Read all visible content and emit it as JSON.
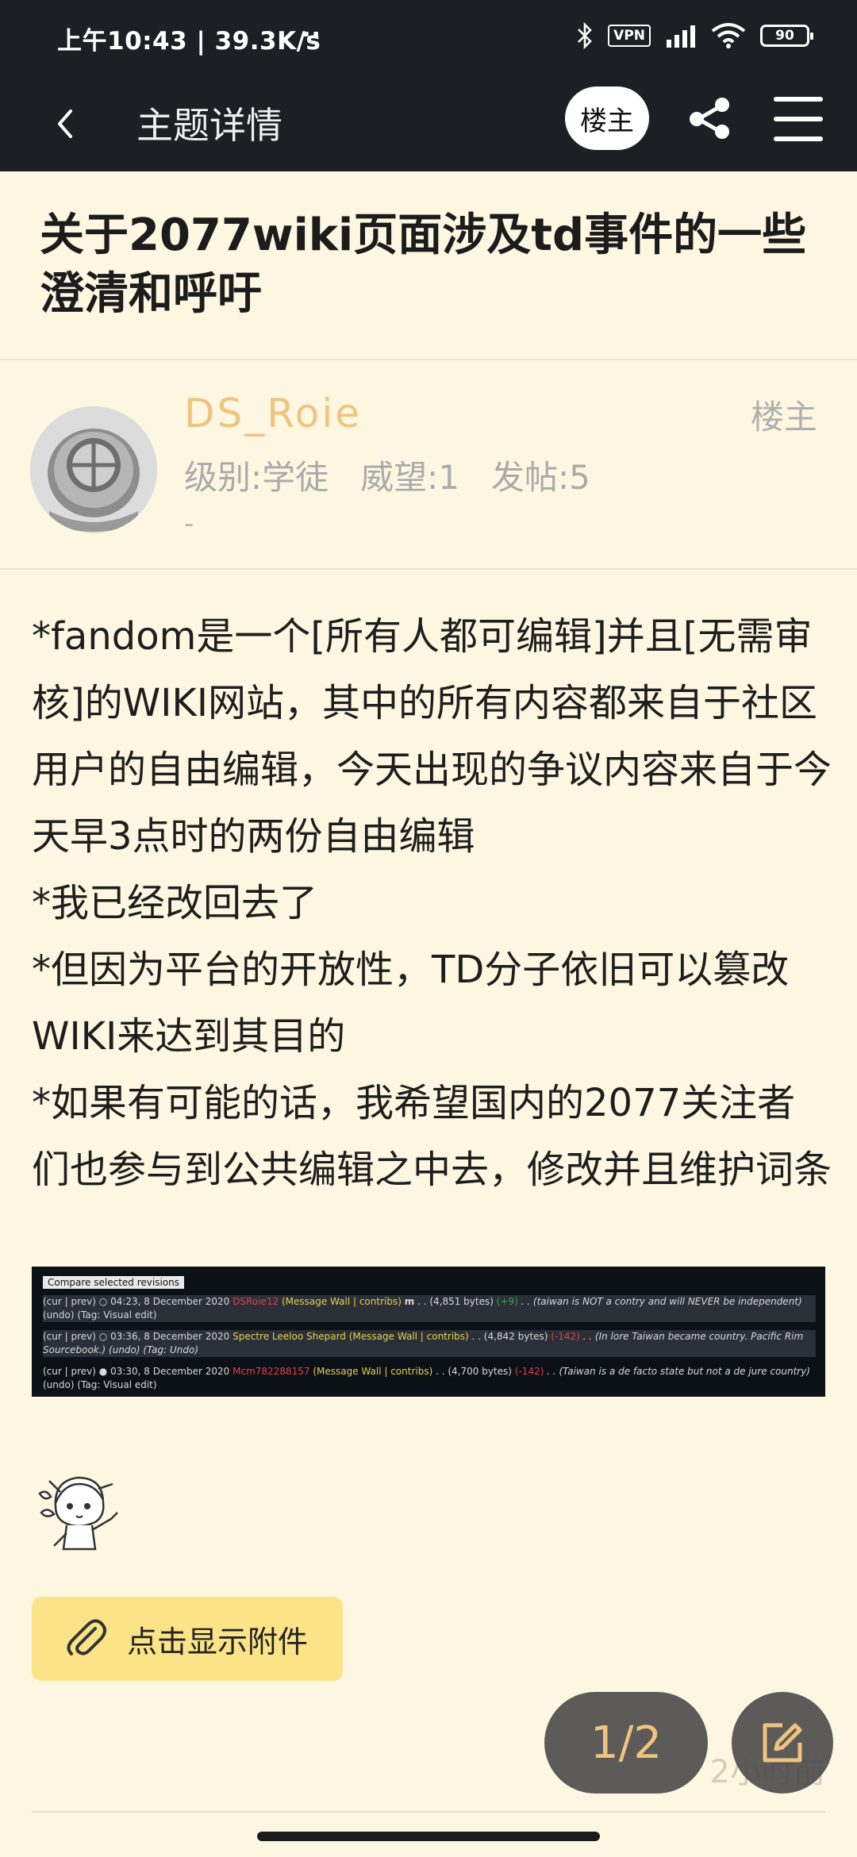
{
  "status_bar": {
    "time_speed": "上午10:43 | 39.3K/s",
    "dots": "··",
    "vpn": "VPN",
    "battery": "90"
  },
  "app_bar": {
    "title": "主题详情",
    "op_button": "楼主"
  },
  "topic": {
    "title": "关于2077wiki页面涉及td事件的一些澄清和呼吁"
  },
  "post": {
    "username": "DS_Roie",
    "level": "级别:学徒",
    "prestige": "威望:1",
    "posts": "发帖:5",
    "signature": "-",
    "op_label": "楼主",
    "paragraphs": [
      "*fandom是一个[所有人都可编辑]并且[无需审核]的WIKI网站，其中的所有内容都来自于社区用户的自由编辑，今天出现的争议内容来自于今天早3点时的两份自由编辑",
      "*我已经改回去了",
      "*但因为平台的开放性，TD分子依旧可以篡改WIKI来达到其目的",
      "*如果有可能的话，我希望国内的2077关注者们也参与到公共编辑之中去，修改并且维护词条"
    ],
    "screenshot": {
      "header": "Compare selected revisions",
      "rows": [
        {
          "prefix": "(cur | prev)",
          "time": "04:23, 8 December 2020",
          "user": "DSRoie12",
          "links": "(Message Wall | contribs)",
          "mark": "m",
          "bytes": ". . (4,851 bytes)",
          "diff": "(+9)",
          "summary": ". . (taiwan is NOT a contry and will NEVER be independent)",
          "tail": "(undo) (Tag: Visual edit)"
        },
        {
          "prefix": "(cur | prev)",
          "time": "03:36, 8 December 2020",
          "user": "Spectre Leeloo Shepard",
          "links": "(Message Wall | contribs)",
          "mark": "",
          "bytes": ". . (4,842 bytes)",
          "diff": "(-142)",
          "summary": ". . (In lore Taiwan became country. Pacific Rim",
          "tail": "Sourcebook.) (undo) (Tag: Undo)"
        },
        {
          "prefix": "(cur | prev)",
          "time": "03:30, 8 December 2020",
          "user": "Mcm782288157",
          "links": "(Message Wall | contribs)",
          "mark": "",
          "bytes": ". . (4,700 bytes)",
          "diff": "(-142)",
          "summary": ". . (Taiwan is a de facto state but not a de jure country)",
          "tail": "(undo) (Tag: Visual edit)"
        }
      ]
    },
    "attachment_button": "点击显示附件",
    "time_ago": "2小时前"
  },
  "pager": {
    "label": "1/2"
  },
  "colors": {
    "bar_bg": "#1d1f24",
    "page_bg": "#fdf7e2",
    "username": "#f0c37e",
    "attach_bg": "#fbe487"
  }
}
